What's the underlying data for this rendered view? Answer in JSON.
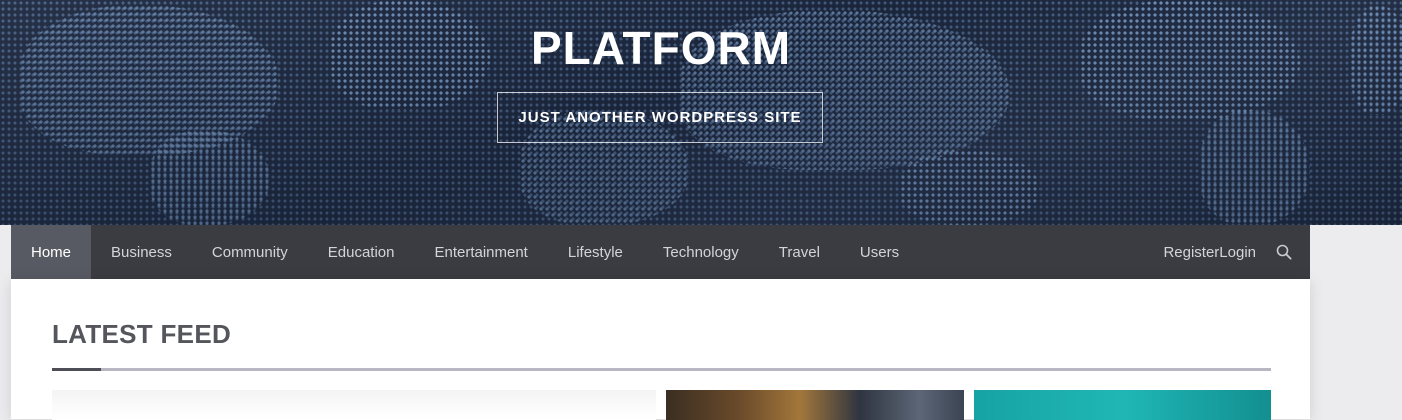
{
  "header": {
    "site_title": "PLATFORM",
    "tagline": "JUST ANOTHER WORDPRESS SITE"
  },
  "nav": {
    "items": [
      {
        "label": "Home",
        "active": true
      },
      {
        "label": "Business",
        "active": false
      },
      {
        "label": "Community",
        "active": false
      },
      {
        "label": "Education",
        "active": false
      },
      {
        "label": "Entertainment",
        "active": false
      },
      {
        "label": "Lifestyle",
        "active": false
      },
      {
        "label": "Technology",
        "active": false
      },
      {
        "label": "Travel",
        "active": false
      },
      {
        "label": "Users",
        "active": false
      }
    ],
    "register_label": "Register",
    "login_label": "Login",
    "search_icon": "search-icon"
  },
  "main": {
    "section_title": "LATEST FEED"
  },
  "colors": {
    "header_bg": "#1e2a42",
    "nav_bg": "#3b3c41",
    "nav_active_bg": "#575a63",
    "accent_rule": "#4c4d55"
  }
}
